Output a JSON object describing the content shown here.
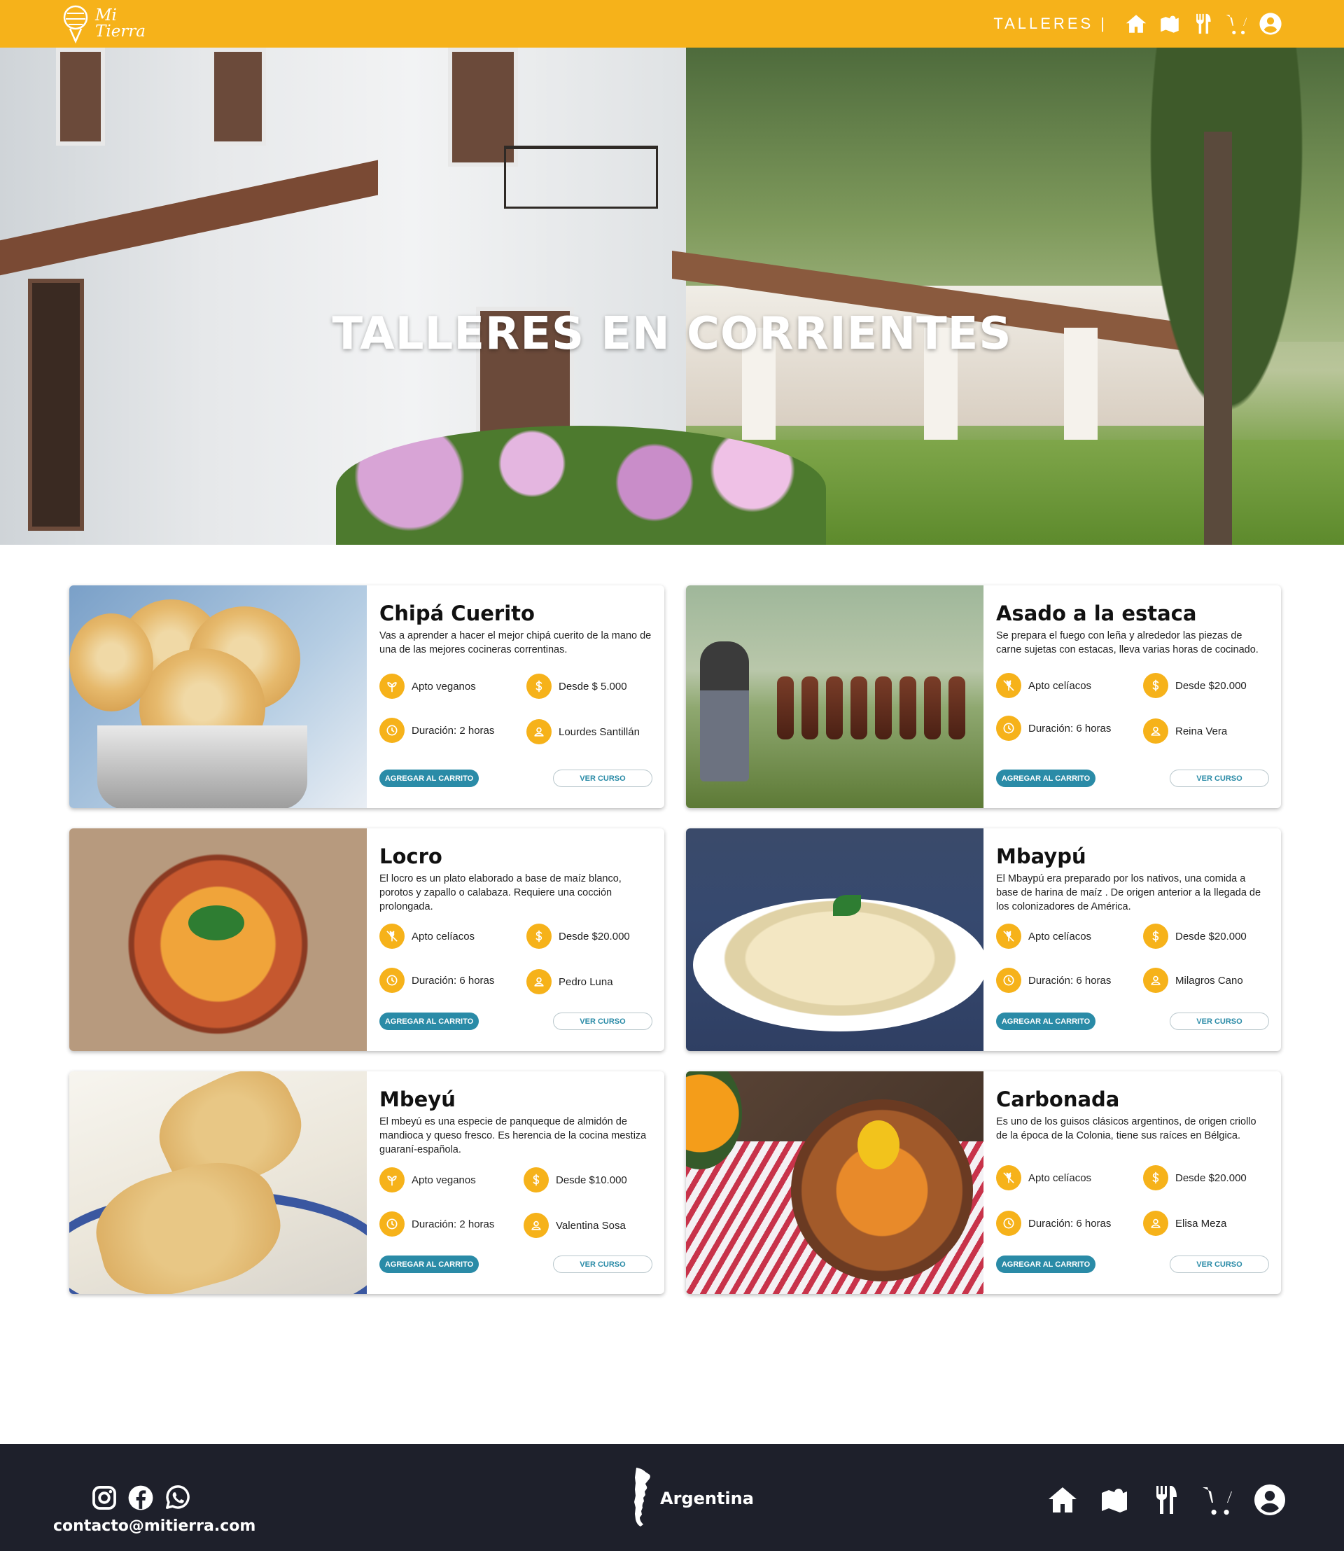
{
  "brand": {
    "logo_line1": "Mi",
    "logo_line2": "Tierra"
  },
  "nav": {
    "link": "TALLERES |",
    "icons": [
      "home-icon",
      "map-icon",
      "utensils-icon",
      "cart-icon",
      "user-icon"
    ]
  },
  "hero": {
    "title": "TALLERES EN CORRIENTES"
  },
  "colors": {
    "primary": "#f6b21a",
    "button": "#2a8ba7",
    "footer": "#1e202b"
  },
  "buttons": {
    "add_to_cart": "AGREGAR AL CARRITO",
    "view_course": "VER CURSO"
  },
  "courses": [
    {
      "title": "Chipá Cuerito",
      "description": "Vas a aprender a hacer el mejor chipá cuerito de la mano de una de las mejores cocineras correntinas.",
      "diet": "Apto veganos",
      "diet_icon": "leaf-icon",
      "price": "Desde $ 5.000",
      "duration": "Duración: 2 horas",
      "teacher": "Lourdes Santillán"
    },
    {
      "title": "Asado a la estaca",
      "description": "Se prepara el fuego con leña y alrededor las piezas de carne sujetas con estacas, lleva varias horas de cocinado.",
      "diet": "Apto celíacos",
      "diet_icon": "no-gluten-icon",
      "price": "Desde $20.000",
      "duration": "Duración: 6 horas",
      "teacher": "Reina Vera"
    },
    {
      "title": "Locro",
      "description": "El locro es un plato elaborado a base de maíz blanco, porotos y zapallo o calabaza. Requiere una cocción prolongada.",
      "diet": "Apto celíacos",
      "diet_icon": "no-gluten-icon",
      "price": "Desde $20.000",
      "duration": "Duración: 6 horas",
      "teacher": "Pedro Luna"
    },
    {
      "title": "Mbaypú",
      "description": "El Mbaypú era preparado por  los nativos, una comida a base de harina de maíz . De origen anterior a la llegada de los colonizadores de América.",
      "diet": "Apto celíacos",
      "diet_icon": "no-gluten-icon",
      "price": "Desde $20.000",
      "duration": "Duración: 6 horas",
      "teacher": "Milagros Cano"
    },
    {
      "title": "Mbeyú",
      "description": "El mbeyú es una especie de panqueque de almidón de mandioca y queso fresco. Es herencia de la cocina mestiza guaraní-española.",
      "diet": "Apto veganos",
      "diet_icon": "leaf-icon",
      "price": "Desde $10.000",
      "duration": "Duración: 2 horas",
      "teacher": "Valentina Sosa"
    },
    {
      "title": "Carbonada",
      "description": "Es uno de los guisos clásicos argentinos, de origen criollo de la época de la Colonia, tiene sus raíces en Bélgica.",
      "diet": "Apto celíacos",
      "diet_icon": "no-gluten-icon",
      "price": "Desde $20.000",
      "duration": "Duración: 6 horas",
      "teacher": "Elisa Meza"
    }
  ],
  "footer": {
    "social_icons": [
      "instagram-icon",
      "facebook-icon",
      "whatsapp-icon"
    ],
    "email": "contacto@mitierra.com",
    "country": "Argentina",
    "icons": [
      "home-icon",
      "map-icon",
      "utensils-icon",
      "cart-icon",
      "user-icon"
    ]
  }
}
